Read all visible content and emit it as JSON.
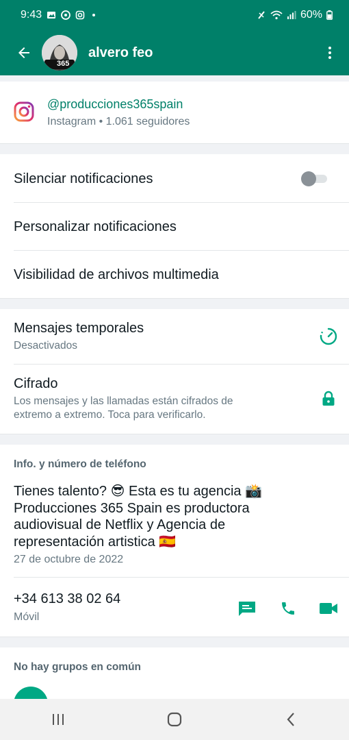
{
  "status_bar": {
    "time": "9:43",
    "battery": "60%",
    "notification_icons": [
      "gallery-icon",
      "whatsapp-icon",
      "instagram-icon",
      "dot-icon"
    ],
    "system_icons": [
      "no-volte-icon",
      "wifi-icon",
      "signal-icon",
      "battery-icon"
    ]
  },
  "header": {
    "contact_name": "alvero feo",
    "avatar_badge": "365"
  },
  "instagram": {
    "handle": "@producciones365spain",
    "subtitle": "Instagram • 1.061 seguidores"
  },
  "notifications": {
    "mute_label": "Silenciar notificaciones",
    "mute_enabled": false,
    "custom_label": "Personalizar notificaciones",
    "media_label": "Visibilidad de archivos multimedia"
  },
  "privacy": {
    "temp_title": "Mensajes temporales",
    "temp_sub": "Desactivados",
    "enc_title": "Cifrado",
    "enc_sub_line1": "Los mensajes y las llamadas están cifrados de",
    "enc_sub_line2": "extremo a extremo. Toca para verificarlo."
  },
  "info": {
    "header": "Info. y número de teléfono",
    "about_line1": "Tienes talento? 😎 Esta es tu agencia 📸",
    "about_line2": "Producciones 365 Spain es productora",
    "about_line3": "audiovisual de Netflix y Agencia de",
    "about_line4": "representación artistica 🇪🇸",
    "date": "27 de octubre de 2022",
    "phone": "+34 613 38 02 64",
    "phone_type": "Móvil"
  },
  "groups": {
    "header": "No hay grupos en común"
  },
  "colors": {
    "brand": "#008069",
    "accent": "#00a884",
    "primary_text": "#111b21",
    "secondary_text": "#667781"
  }
}
